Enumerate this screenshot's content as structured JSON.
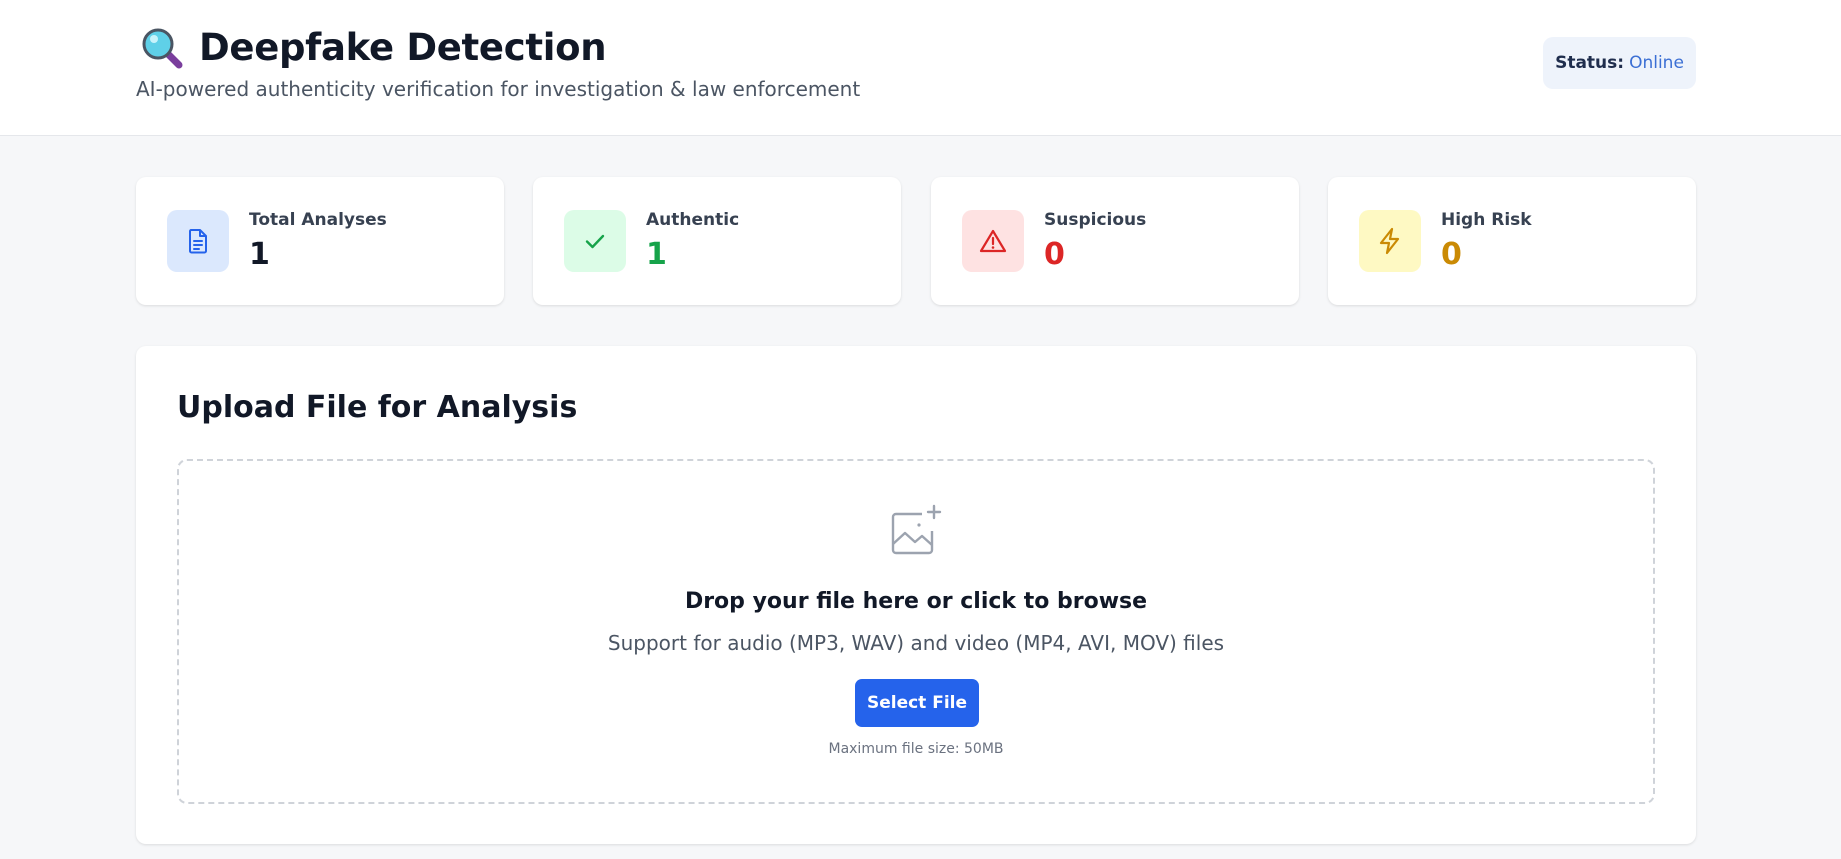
{
  "header": {
    "title": "Deepfake Detection",
    "subtitle": "AI-powered authenticity verification for investigation & law enforcement",
    "logo_icon": "magnifying-glass-icon",
    "status_label": "Status:",
    "status_value": "Online"
  },
  "stats": [
    {
      "label": "Total Analyses",
      "value": "1",
      "icon": "document-icon",
      "color": "#111827",
      "icon_bg": "#dbe8fd",
      "icon_color": "#2563eb"
    },
    {
      "label": "Authentic",
      "value": "1",
      "icon": "check-icon",
      "color": "#16a34a",
      "icon_bg": "#dcfce7",
      "icon_color": "#16a34a"
    },
    {
      "label": "Suspicious",
      "value": "0",
      "icon": "warning-triangle-icon",
      "color": "#dc2626",
      "icon_bg": "#fee2e2",
      "icon_color": "#dc2626"
    },
    {
      "label": "High Risk",
      "value": "0",
      "icon": "lightning-icon",
      "color": "#ca8a04",
      "icon_bg": "#fef9c3",
      "icon_color": "#ca8a04"
    }
  ],
  "upload": {
    "title": "Upload File for Analysis",
    "drop_icon": "image-add-icon",
    "drop_heading": "Drop your file here or click to browse",
    "support_text": "Support for audio (MP3, WAV) and video (MP4, AVI, MOV) files",
    "button_label": "Select File",
    "max_size": "Maximum file size: 50MB"
  },
  "colors": {
    "accent": "#2563eb",
    "page_bg": "#f6f7f9"
  }
}
